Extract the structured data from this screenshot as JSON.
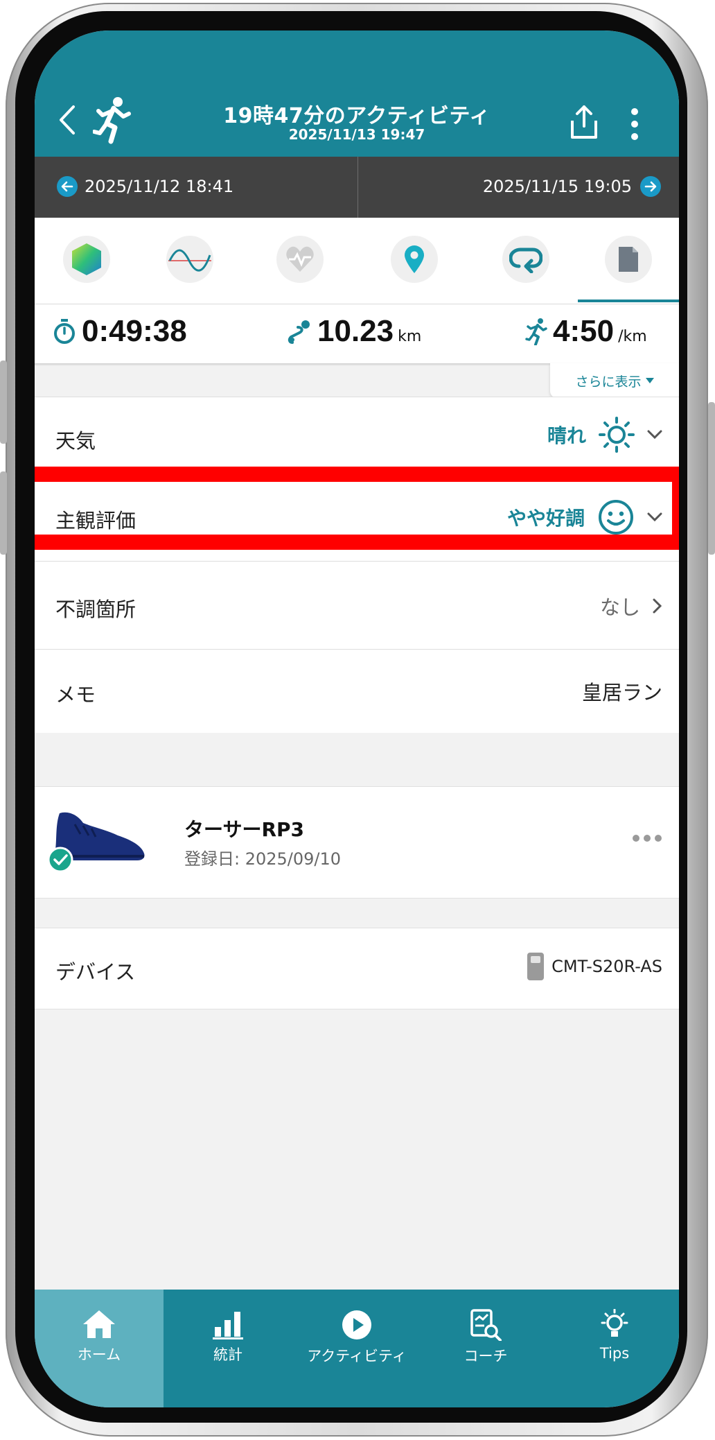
{
  "header": {
    "title": "19時47分のアクティビティ",
    "subtitle": "2025/11/13 19:47"
  },
  "date_nav": {
    "prev": "2025/11/12 18:41",
    "next": "2025/11/15 19:05"
  },
  "stats": {
    "time": "0:49:38",
    "distance": "10.23",
    "distance_unit": "km",
    "pace": "4:50",
    "pace_unit": "/km",
    "more_label": "さらに表示"
  },
  "details": {
    "weather_label": "天気",
    "weather_value": "晴れ",
    "rating_label": "主観評価",
    "rating_value": "やや好調",
    "discomfort_label": "不調箇所",
    "discomfort_value": "なし",
    "memo_label": "メモ",
    "memo_value": "皇居ラン"
  },
  "shoe": {
    "name": "ターサーRP3",
    "registered": "登録日: 2025/09/10"
  },
  "device": {
    "label": "デバイス",
    "value": "CMT-S20R-AS"
  },
  "bottom_nav": [
    {
      "label": "ホーム"
    },
    {
      "label": "統計"
    },
    {
      "label": "アクティビティ"
    },
    {
      "label": "コーチ"
    },
    {
      "label": "Tips"
    }
  ],
  "colors": {
    "accent": "#1a8597",
    "date_bar": "#424242",
    "highlight": "#ff0000",
    "nav_active": "#5eb1bf"
  }
}
